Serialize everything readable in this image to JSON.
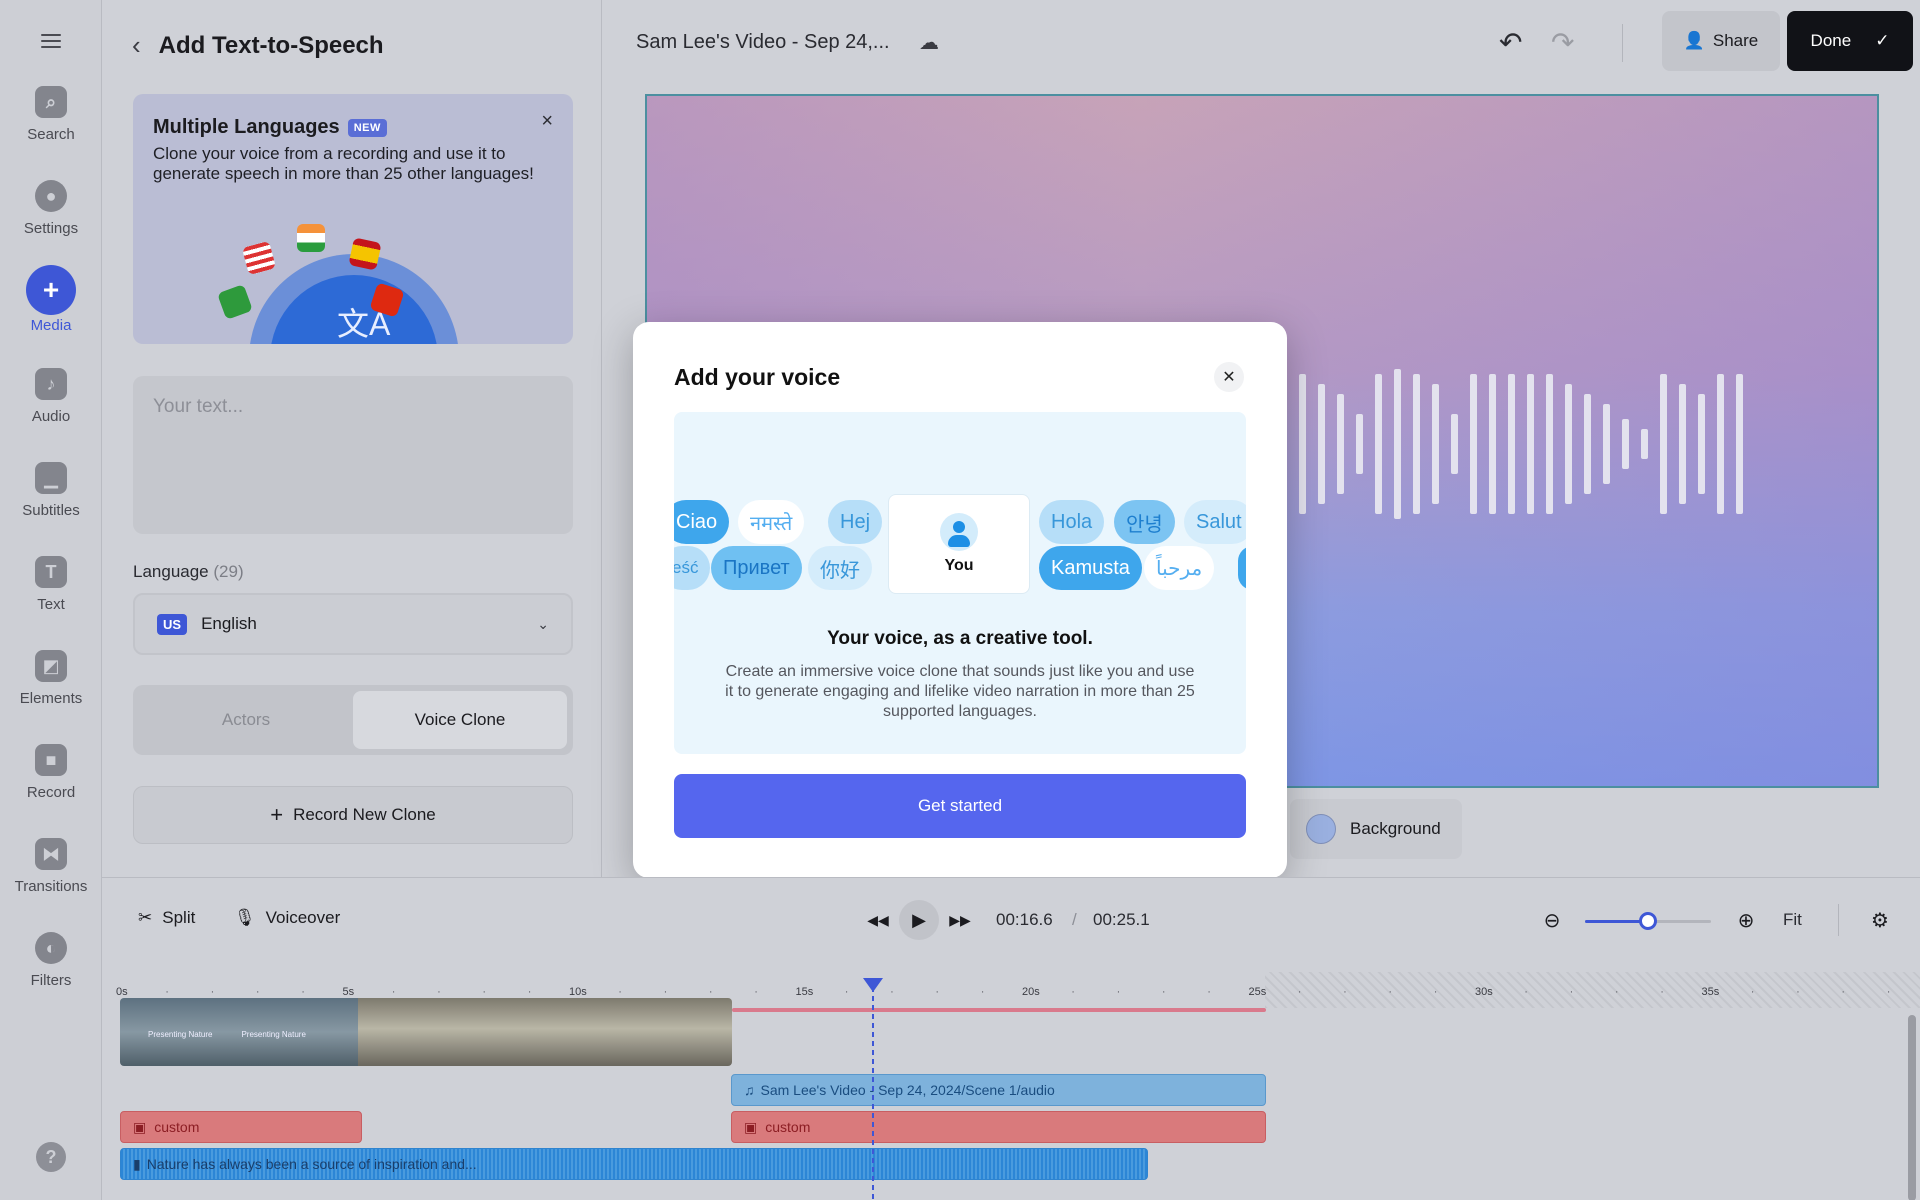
{
  "rail": {
    "items": [
      {
        "label": "Search",
        "icon": "search-icon"
      },
      {
        "label": "Settings",
        "icon": "settings-icon"
      },
      {
        "label": "Media",
        "icon": "plus-icon"
      },
      {
        "label": "Audio",
        "icon": "music-icon"
      },
      {
        "label": "Subtitles",
        "icon": "subtitles-icon"
      },
      {
        "label": "Text",
        "icon": "text-icon"
      },
      {
        "label": "Elements",
        "icon": "elements-icon"
      },
      {
        "label": "Record",
        "icon": "record-icon"
      },
      {
        "label": "Transitions",
        "icon": "transitions-icon"
      },
      {
        "label": "Filters",
        "icon": "filters-icon"
      }
    ],
    "active": "Media",
    "help": "?"
  },
  "panel": {
    "title": "Add Text-to-Speech",
    "promo": {
      "title": "Multiple Languages",
      "badge": "NEW",
      "description": "Clone your voice from a recording and use it to generate speech in more than 25 other languages!"
    },
    "text_placeholder": "Your text...",
    "language_label": "Language",
    "language_count": "(29)",
    "language_flag": "US",
    "language_value": "English",
    "tabs": [
      "Actors",
      "Voice Clone"
    ],
    "active_tab": "Voice Clone",
    "record_label": "Record New Clone"
  },
  "topbar": {
    "video_title": "Sam Lee's Video - Sep 24,...",
    "share_label": "Share",
    "done_label": "Done"
  },
  "canvas": {
    "background_label": "Background"
  },
  "modal": {
    "title": "Add your voice",
    "you_label": "You",
    "chips_row1": [
      "Ciao",
      "नमस्ते",
      "Hej",
      "Hola",
      "안녕",
      "Salut"
    ],
    "chips_row2": [
      "eść",
      "Привет",
      "你好",
      "Kamusta",
      "مرحباً"
    ],
    "heading": "Your voice, as a creative tool.",
    "description": "Create an immersive voice clone that sounds just like you and use it to generate engaging and lifelike video narration in more than 25 supported languages.",
    "cta": "Get started"
  },
  "toolbar": {
    "split_label": "Split",
    "voiceover_label": "Voiceover",
    "current_time": "00:16.6",
    "separator": "/",
    "total_time": "00:25.1",
    "fit_label": "Fit",
    "zoom_level": 0.5
  },
  "timeline": {
    "ruler": [
      "0s",
      "5s",
      "10s",
      "15s",
      "20s",
      "25s",
      "30s",
      "35s"
    ],
    "thumb_text": "Presenting Nature",
    "audio_clip": "Sam Lee's Video - Sep 24, 2024/Scene 1/audio",
    "custom_label": "custom",
    "voice_clip": "Nature has always been a source of inspiration and..."
  },
  "colors": {
    "accent": "#3e57d6",
    "cta": "#5566ee",
    "done_bg": "#111217"
  }
}
